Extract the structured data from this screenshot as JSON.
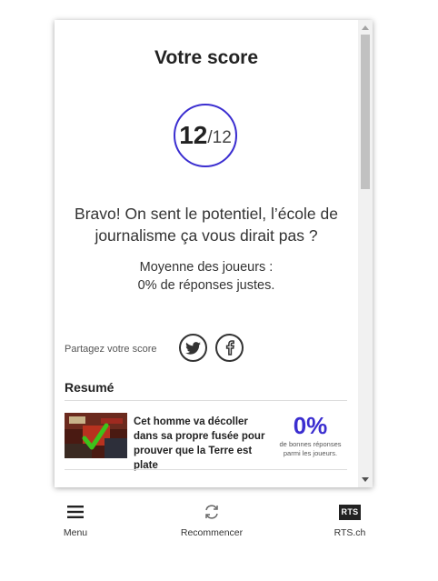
{
  "card": {
    "title": "Votre score",
    "score": {
      "value": "12",
      "total": "/12"
    },
    "message": "Bravo! On sent le potentiel, l’école de journalisme ça vous dirait pas ?",
    "average_line1": "Moyenne des joueurs :",
    "average_line2": "0% de réponses justes.",
    "share_label": "Partagez votre score",
    "social": [
      "twitter-icon",
      "facebook-icon"
    ],
    "summary_title": "Resumé",
    "items": [
      {
        "text": "Cet homme va décoller dans sa propre fusée pour prouver que la Terre est plate",
        "percent": "0%",
        "percent_label": "de bonnes réponses parmi les joueurs."
      }
    ],
    "next_item_partial": "… … … … …"
  },
  "nav": {
    "menu_label": "Menu",
    "restart_label": "Recommencer",
    "rts_label": "RTS.ch",
    "rts_logo": "RTS"
  },
  "colors": {
    "accent": "#3b2ed0",
    "text": "#222222"
  }
}
